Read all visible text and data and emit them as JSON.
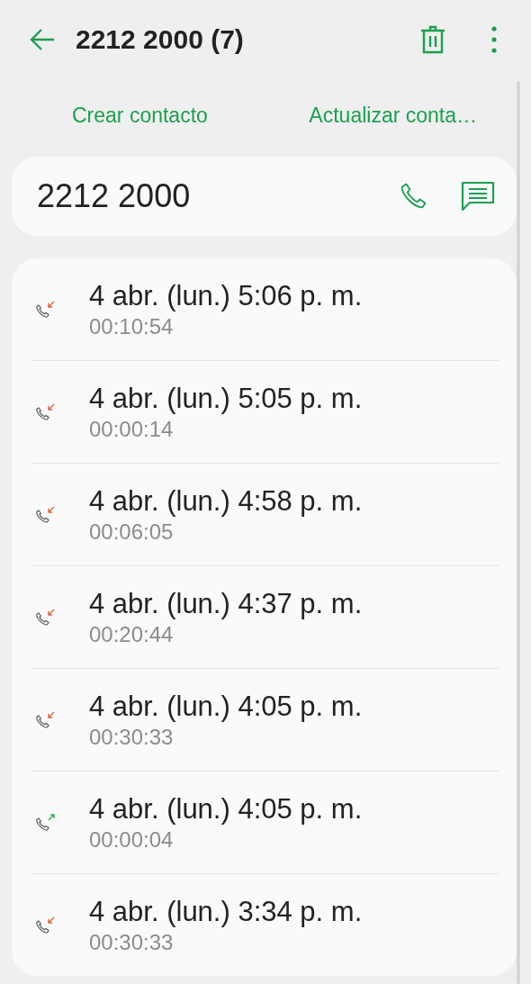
{
  "header": {
    "title": "2212 2000 (7)"
  },
  "actions": [
    "Crear contacto",
    "Actualizar conta…"
  ],
  "number_card": {
    "number": "2212 2000"
  },
  "calls": [
    {
      "kind": "incoming",
      "time": "4 abr. (lun.) 5:06 p. m.",
      "duration": "00:10:54"
    },
    {
      "kind": "incoming",
      "time": "4 abr. (lun.) 5:05 p. m.",
      "duration": "00:00:14"
    },
    {
      "kind": "incoming",
      "time": "4 abr. (lun.) 4:58 p. m.",
      "duration": "00:06:05"
    },
    {
      "kind": "incoming",
      "time": "4 abr. (lun.) 4:37 p. m.",
      "duration": "00:20:44"
    },
    {
      "kind": "incoming",
      "time": "4 abr. (lun.) 4:05 p. m.",
      "duration": "00:30:33"
    },
    {
      "kind": "outgoing",
      "time": "4 abr. (lun.) 4:05 p. m.",
      "duration": "00:00:04"
    },
    {
      "kind": "incoming",
      "time": "4 abr. (lun.) 3:34 p. m.",
      "duration": "00:30:33"
    }
  ]
}
